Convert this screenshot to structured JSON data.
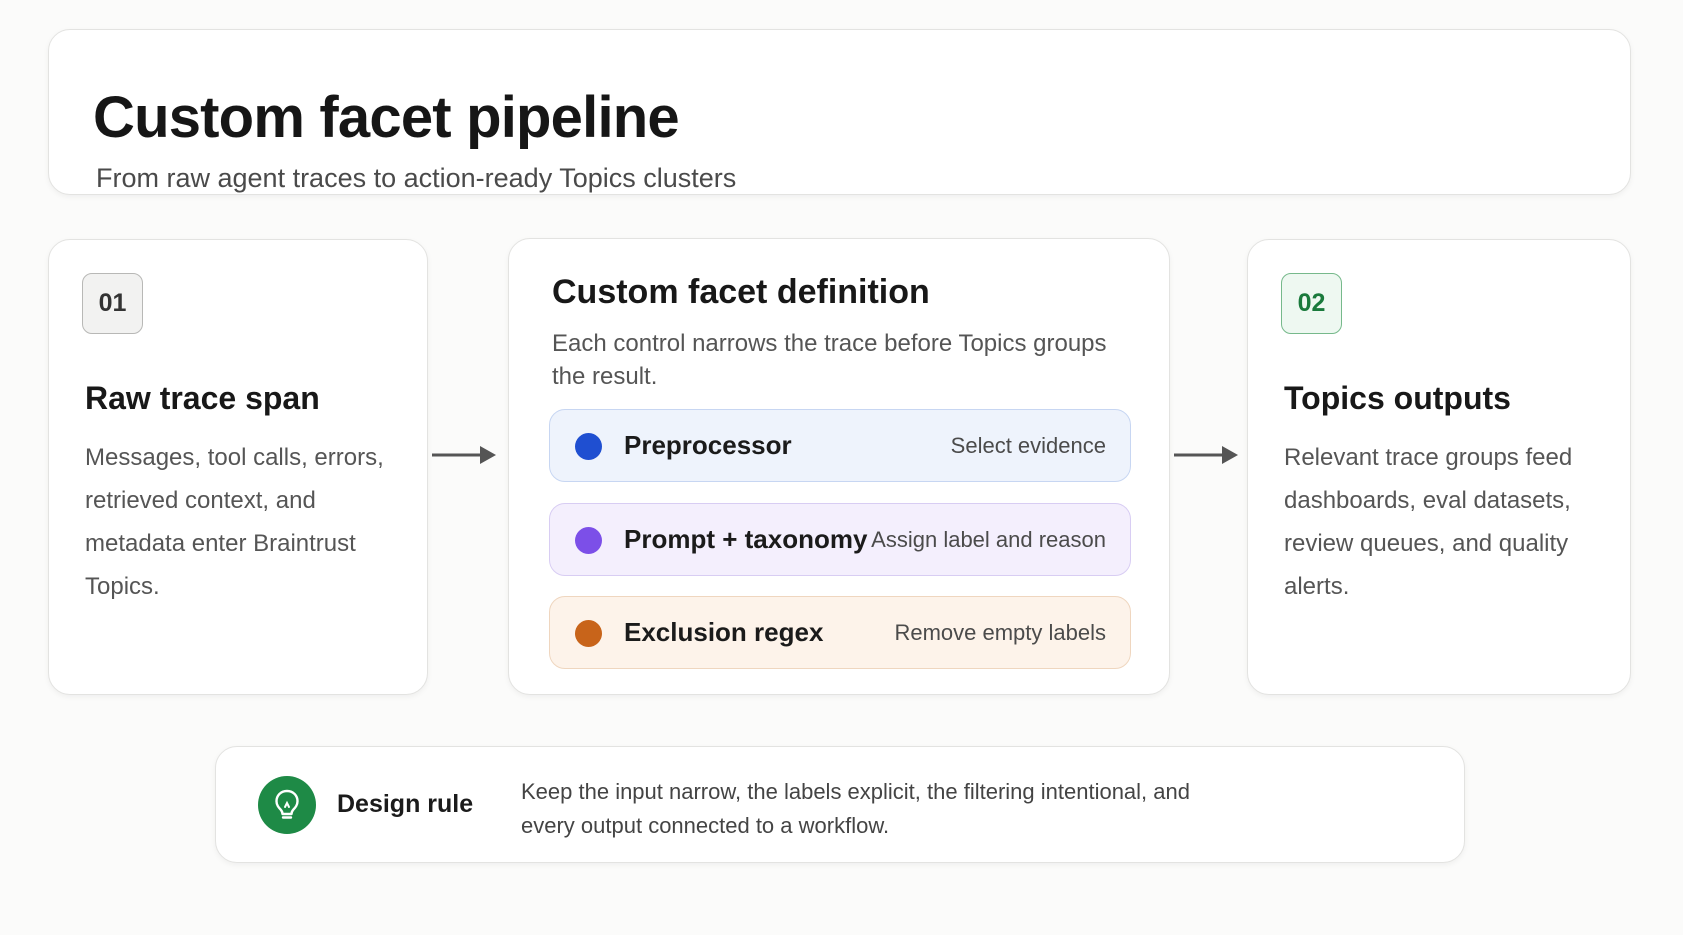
{
  "header": {
    "title": "Custom facet pipeline",
    "subtitle": "From raw agent traces to action-ready Topics clusters"
  },
  "step1": {
    "badge": "01",
    "title": "Raw trace span",
    "body": "Messages, tool calls, errors, retrieved context, and metadata enter Braintrust Topics."
  },
  "middle": {
    "title": "Custom facet definition",
    "description": "Each control narrows the trace before Topics groups the result.",
    "controls": [
      {
        "name": "Preprocessor",
        "desc": "Select evidence",
        "color": "#1f4fd1"
      },
      {
        "name": "Prompt + taxonomy",
        "desc": "Assign label and reason",
        "color": "#7c4fe8"
      },
      {
        "name": "Exclusion regex",
        "desc": "Remove empty labels",
        "color": "#c8641a"
      }
    ]
  },
  "step2": {
    "badge": "02",
    "title": "Topics outputs",
    "body": "Relevant trace groups feed dashboards, eval datasets, review queues, and quality alerts."
  },
  "rule": {
    "icon": "lightbulb-icon",
    "label": "Design rule",
    "text": "Keep the input narrow, the labels explicit, the filtering intentional, and every output connected to a workflow."
  }
}
